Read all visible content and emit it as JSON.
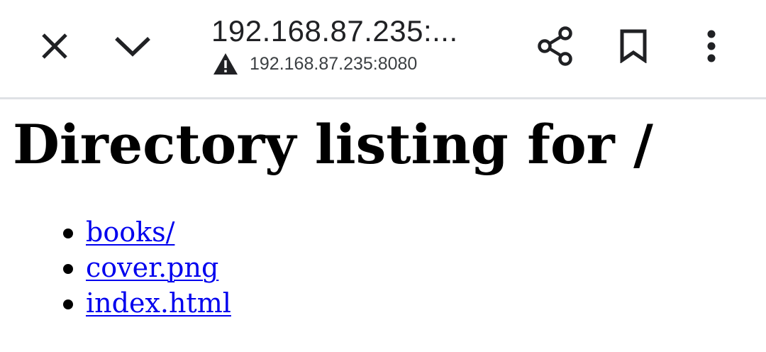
{
  "toolbar": {
    "page_title": "192.168.87.235:...",
    "url": "192.168.87.235:8080",
    "icons": {
      "close": "close-icon",
      "dropdown": "chevron-down-icon",
      "security": "warning-icon",
      "share": "share-icon",
      "bookmark": "bookmark-icon",
      "menu": "more-vert-icon"
    }
  },
  "page": {
    "heading": "Directory listing for /",
    "entries": [
      {
        "name": "books/"
      },
      {
        "name": "cover.png"
      },
      {
        "name": "index.html"
      }
    ]
  },
  "colors": {
    "link": "#0000ee",
    "divider": "#dfe1e5",
    "icon": "#202124"
  }
}
